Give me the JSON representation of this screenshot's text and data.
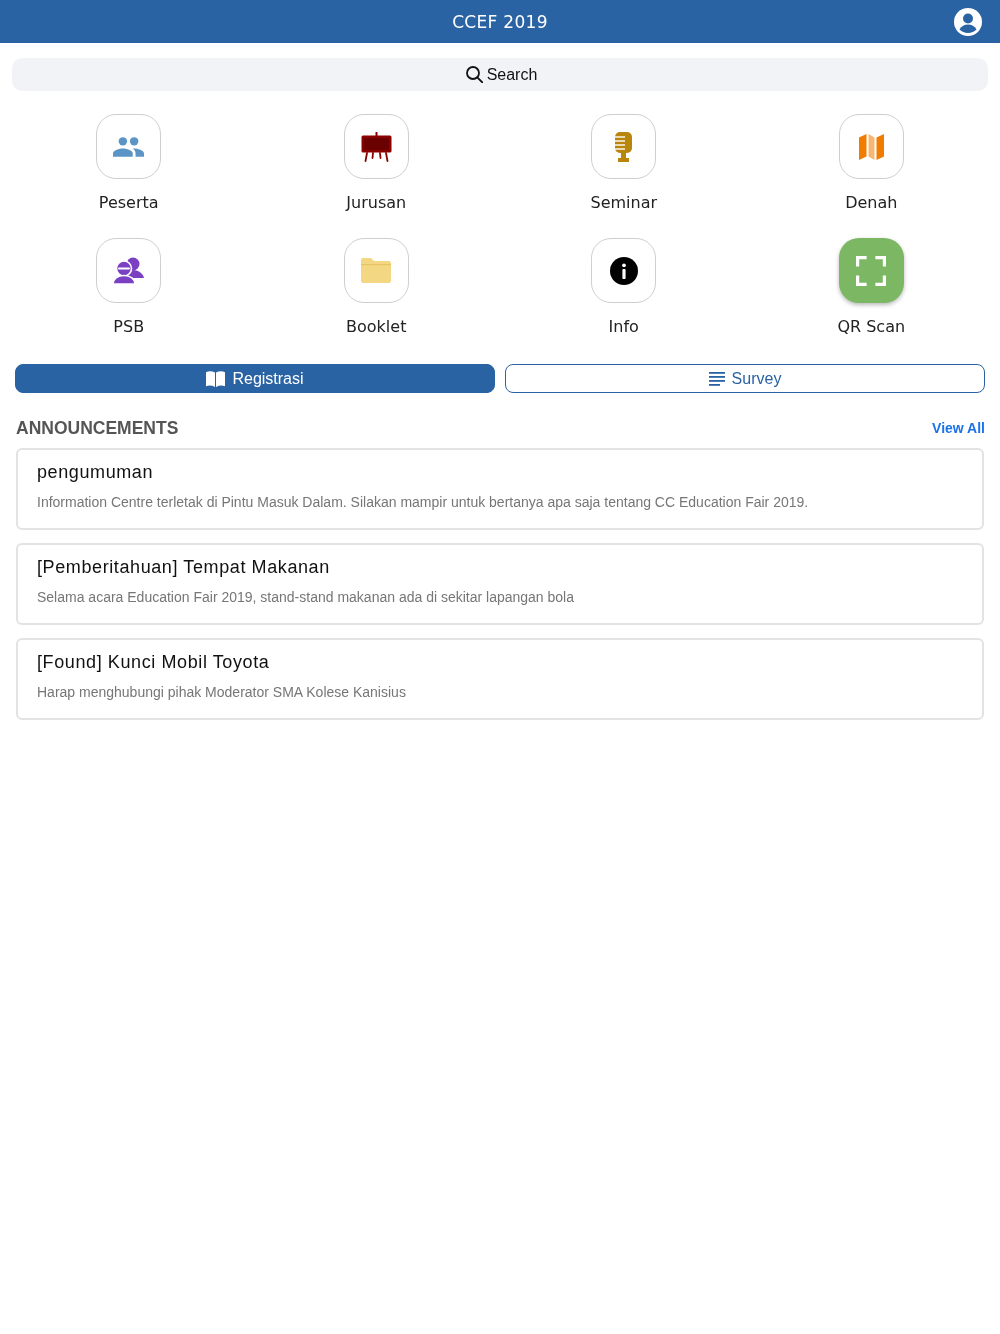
{
  "header": {
    "title": "CCEF 2019"
  },
  "search": {
    "placeholder": "Search"
  },
  "shortcuts": [
    {
      "label": "Peserta",
      "kind": "outline",
      "color": "#5b95c6"
    },
    {
      "label": "Jurusan",
      "kind": "outline",
      "color": "#8b0000"
    },
    {
      "label": "Seminar",
      "kind": "outline",
      "color": "#b8860b"
    },
    {
      "label": "Denah",
      "kind": "outline",
      "color": "#f07c00"
    },
    {
      "label": "PSB",
      "kind": "outline",
      "color": "#7b3fc4"
    },
    {
      "label": "Booklet",
      "kind": "outline",
      "color": "#f3d782"
    },
    {
      "label": "Info",
      "kind": "outline",
      "color": "#000000"
    },
    {
      "label": "QR Scan",
      "kind": "filled",
      "color": "#7cb863"
    }
  ],
  "actions": [
    {
      "label": "Registrasi",
      "kind": "filled"
    },
    {
      "label": "Survey",
      "kind": "outline"
    }
  ],
  "announcements": {
    "title": "ANNOUNCEMENTS",
    "view_all": "View All",
    "items": [
      {
        "title": "pengumuman",
        "body": "Information Centre terletak di Pintu Masuk Dalam. Silakan mampir untuk bertanya apa saja tentang CC Education Fair 2019."
      },
      {
        "title": "[Pemberitahuan] Tempat Makanan",
        "body": "Selama acara Education Fair 2019, stand-stand makanan ada di sekitar lapangan bola"
      },
      {
        "title": "[Found] Kunci Mobil Toyota",
        "body": "Harap menghubungi pihak Moderator SMA Kolese Kanisius"
      }
    ]
  }
}
